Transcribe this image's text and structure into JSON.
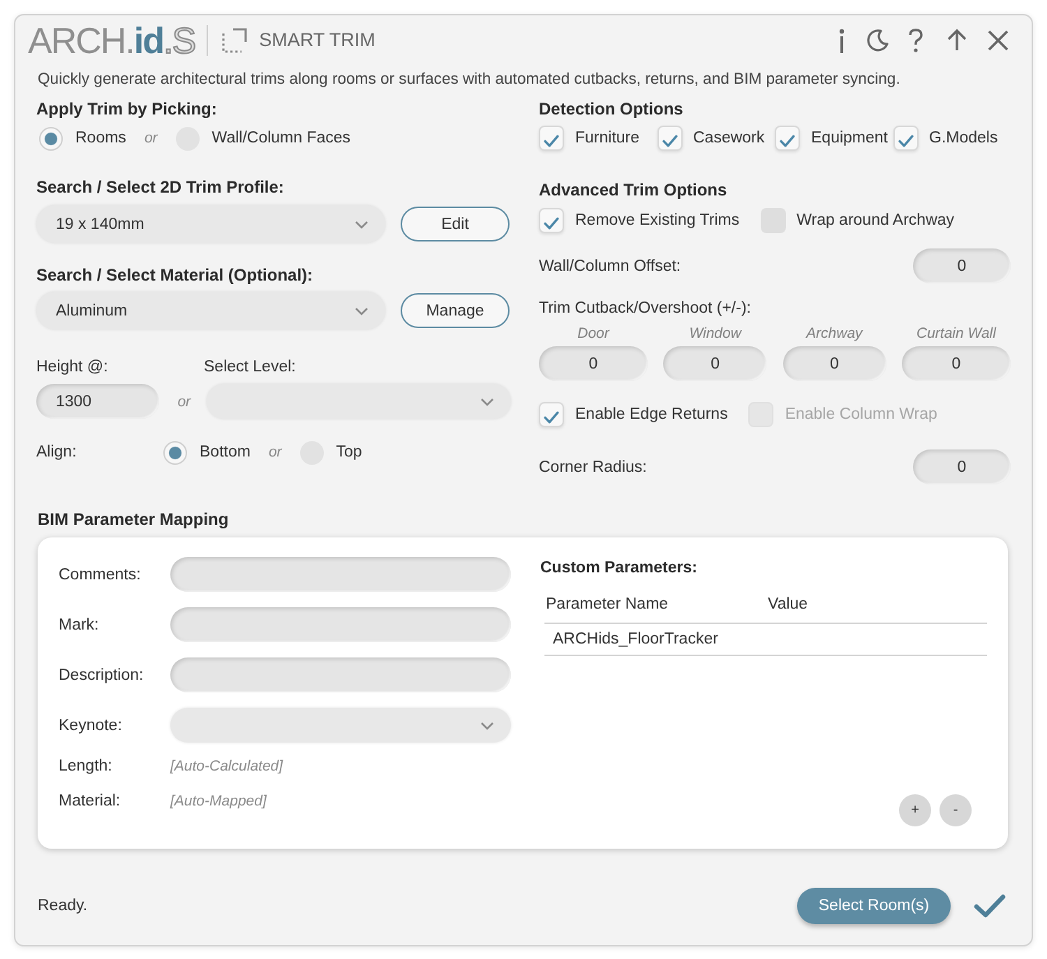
{
  "window": {
    "logo": [
      {
        "text": "ARCH.",
        "kind": "light"
      },
      {
        "text": "id",
        "kind": "accent"
      },
      {
        "text": ".S",
        "kind": "outline"
      }
    ],
    "title": "SMART TRIM"
  },
  "description": "Quickly generate architectural trims along rooms or surfaces with automated cutbacks, returns, and BIM parameter syncing.",
  "pick_mode": {
    "label": "Apply Trim by Picking:",
    "separator": "or",
    "options": [
      {
        "label": "Rooms",
        "selected": true
      },
      {
        "label": "Wall/Column Faces",
        "selected": false
      }
    ]
  },
  "profile": {
    "label": "Search / Select 2D Trim Profile:",
    "value": "19 x 140mm",
    "button": "Edit"
  },
  "material": {
    "label": "Search / Select Material (Optional):",
    "value": "Aluminum",
    "button": "Manage"
  },
  "height": {
    "label": "Height @:",
    "value": "1300",
    "separator": "or"
  },
  "level": {
    "label": "Select Level:"
  },
  "align": {
    "label": "Align:",
    "separator": "or",
    "options": [
      {
        "label": "Bottom",
        "selected": true
      },
      {
        "label": "Top",
        "selected": false
      }
    ]
  },
  "detection": {
    "title": "Detection Options",
    "options": [
      {
        "label": "Furniture",
        "checked": true
      },
      {
        "label": "Casework",
        "checked": true
      },
      {
        "label": "Equipment",
        "checked": true
      },
      {
        "label": "G.Models",
        "checked": true
      }
    ]
  },
  "advanced": {
    "title": "Advanced Trim Options",
    "options": [
      {
        "label": "Remove Existing Trims",
        "checked": true
      },
      {
        "label": "Wrap around Archway",
        "checked": false
      }
    ],
    "offset": {
      "label": "Wall/Column Offset:",
      "value": "0"
    },
    "cutback": {
      "label": "Trim Cutback/Overshoot (+/-):",
      "fields": [
        {
          "label": "Door",
          "value": "0"
        },
        {
          "label": "Window",
          "value": "0"
        },
        {
          "label": "Archway",
          "value": "0"
        },
        {
          "label": "Curtain Wall",
          "value": "0"
        }
      ]
    },
    "returns": [
      {
        "label": "Enable Edge Returns",
        "checked": true,
        "disabled": false
      },
      {
        "label": "Enable Column Wrap",
        "checked": false,
        "disabled": true
      }
    ],
    "corner_radius": {
      "label": "Corner Radius:",
      "value": "0"
    }
  },
  "bim": {
    "title": "BIM Parameter Mapping",
    "fields": [
      {
        "label": "Comments:",
        "kind": "text"
      },
      {
        "label": "Mark:",
        "kind": "text"
      },
      {
        "label": "Description:",
        "kind": "text"
      },
      {
        "label": "Keynote:",
        "kind": "select"
      },
      {
        "label": "Length:",
        "kind": "auto",
        "value": "[Auto-Calculated]"
      },
      {
        "label": "Material:",
        "kind": "auto",
        "value": "[Auto-Mapped]"
      }
    ],
    "custom": {
      "title": "Custom Parameters:",
      "columns": [
        "Parameter Name",
        "Value"
      ],
      "rows": [
        [
          "ARCHids_FloorTracker"
        ]
      ],
      "buttons": [
        "+",
        "-"
      ]
    }
  },
  "status_bar": {
    "text": "Ready.",
    "button": "Select Room(s)"
  }
}
